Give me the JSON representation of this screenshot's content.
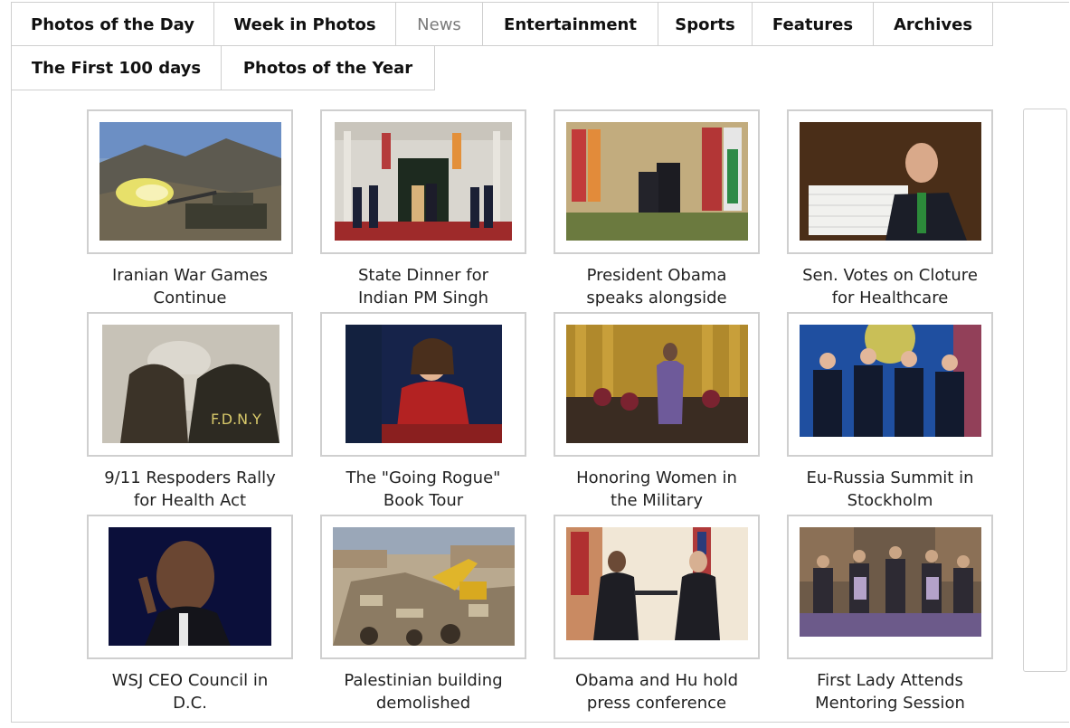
{
  "tabs": [
    {
      "label": "Photos of the Day",
      "active": false
    },
    {
      "label": "Week in Photos",
      "active": false
    },
    {
      "label": "News",
      "active": true
    },
    {
      "label": "Entertainment",
      "active": false
    },
    {
      "label": "Sports",
      "active": false
    },
    {
      "label": "Features",
      "active": false
    },
    {
      "label": "Archives",
      "active": false
    },
    {
      "label": "The First 100 days",
      "active": false
    },
    {
      "label": "Photos of the Year",
      "active": false
    }
  ],
  "gallery": [
    {
      "caption_line1": "Iranian War Games",
      "caption_line2": "Continue"
    },
    {
      "caption_line1": "State Dinner for",
      "caption_line2": "Indian PM Singh"
    },
    {
      "caption_line1": "President Obama",
      "caption_line2": "speaks alongside"
    },
    {
      "caption_line1": "Sen. Votes on Cloture",
      "caption_line2": "for Healthcare"
    },
    {
      "caption_line1": "9/11 Respoders Rally",
      "caption_line2": "for Health Act"
    },
    {
      "caption_line1": "The \"Going Rogue\"",
      "caption_line2": "Book Tour"
    },
    {
      "caption_line1": "Honoring Women in",
      "caption_line2": "the Military"
    },
    {
      "caption_line1": "Eu-Russia Summit in",
      "caption_line2": "Stockholm"
    },
    {
      "caption_line1": "WSJ CEO Council in",
      "caption_line2": "D.C."
    },
    {
      "caption_line1": "Palestinian building",
      "caption_line2": "demolished"
    },
    {
      "caption_line1": "Obama and Hu hold",
      "caption_line2": "press conference"
    },
    {
      "caption_line1": "First Lady Attends",
      "caption_line2": "Mentoring Session"
    }
  ],
  "photo_text": {
    "fdny": "F.D.N.Y"
  }
}
